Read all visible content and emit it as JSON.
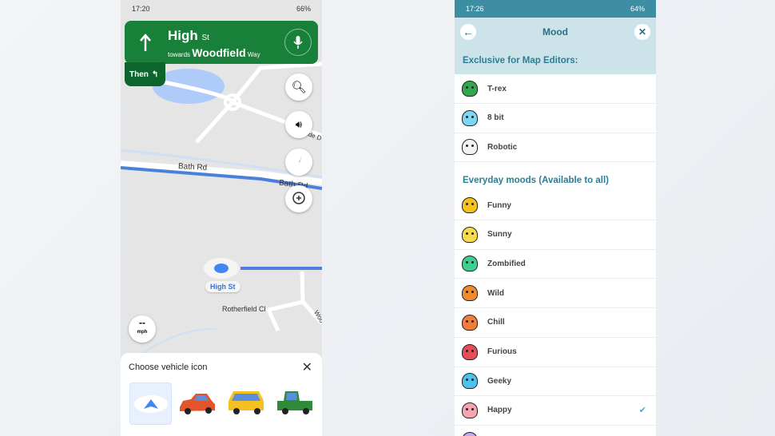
{
  "left_phone": {
    "status": {
      "time": "17:20",
      "battery": "66%"
    },
    "nav": {
      "street": "High",
      "street_suffix": "St",
      "towards_label": "towards",
      "towards_street": "Woodfield",
      "towards_suffix": "Way",
      "then_label": "Then",
      "direction_icon": "arrow-up-icon",
      "then_icon": "turn-left-icon"
    },
    "map": {
      "road_labels": [
        "Bath Rd",
        "Bath Rd",
        "ide D",
        "Rotherfield Cl",
        "Woo"
      ],
      "current_location_label": "High St",
      "route_color": "#4a7fdc",
      "speed": {
        "value": "--",
        "unit": "mph"
      }
    },
    "buttons": [
      "search-icon",
      "volume-icon",
      "compass-icon",
      "add-report-icon"
    ],
    "vehicle_sheet": {
      "title": "Choose vehicle icon",
      "options": [
        "Navigation arrow",
        "Red car",
        "Yellow SUV",
        "Green truck"
      ],
      "selected": 0
    }
  },
  "right_phone": {
    "status": {
      "time": "17:26",
      "battery": "64%"
    },
    "header": {
      "title": "Mood"
    },
    "sections": [
      {
        "title": "Exclusive for Map Editors:",
        "items": [
          {
            "label": "T-rex",
            "color": "#2fa84f"
          },
          {
            "label": "8 bit",
            "color": "#7fd6f2"
          },
          {
            "label": "Robotic",
            "color": "#f2f2f2"
          }
        ]
      },
      {
        "title": "Everyday moods (Available to all)",
        "items": [
          {
            "label": "Funny",
            "color": "#f4c21b"
          },
          {
            "label": "Sunny",
            "color": "#f6dc4a"
          },
          {
            "label": "Zombified",
            "color": "#3ccf8e"
          },
          {
            "label": "Wild",
            "color": "#f08a2a"
          },
          {
            "label": "Chill",
            "color": "#f07d3c"
          },
          {
            "label": "Furious",
            "color": "#e94c55"
          },
          {
            "label": "Geeky",
            "color": "#4bc3ee"
          },
          {
            "label": "Happy",
            "color": "#f3a6b0",
            "selected": true
          },
          {
            "label": "",
            "color": "#c7a8e8"
          }
        ]
      }
    ],
    "accent": "#3aaee0"
  }
}
